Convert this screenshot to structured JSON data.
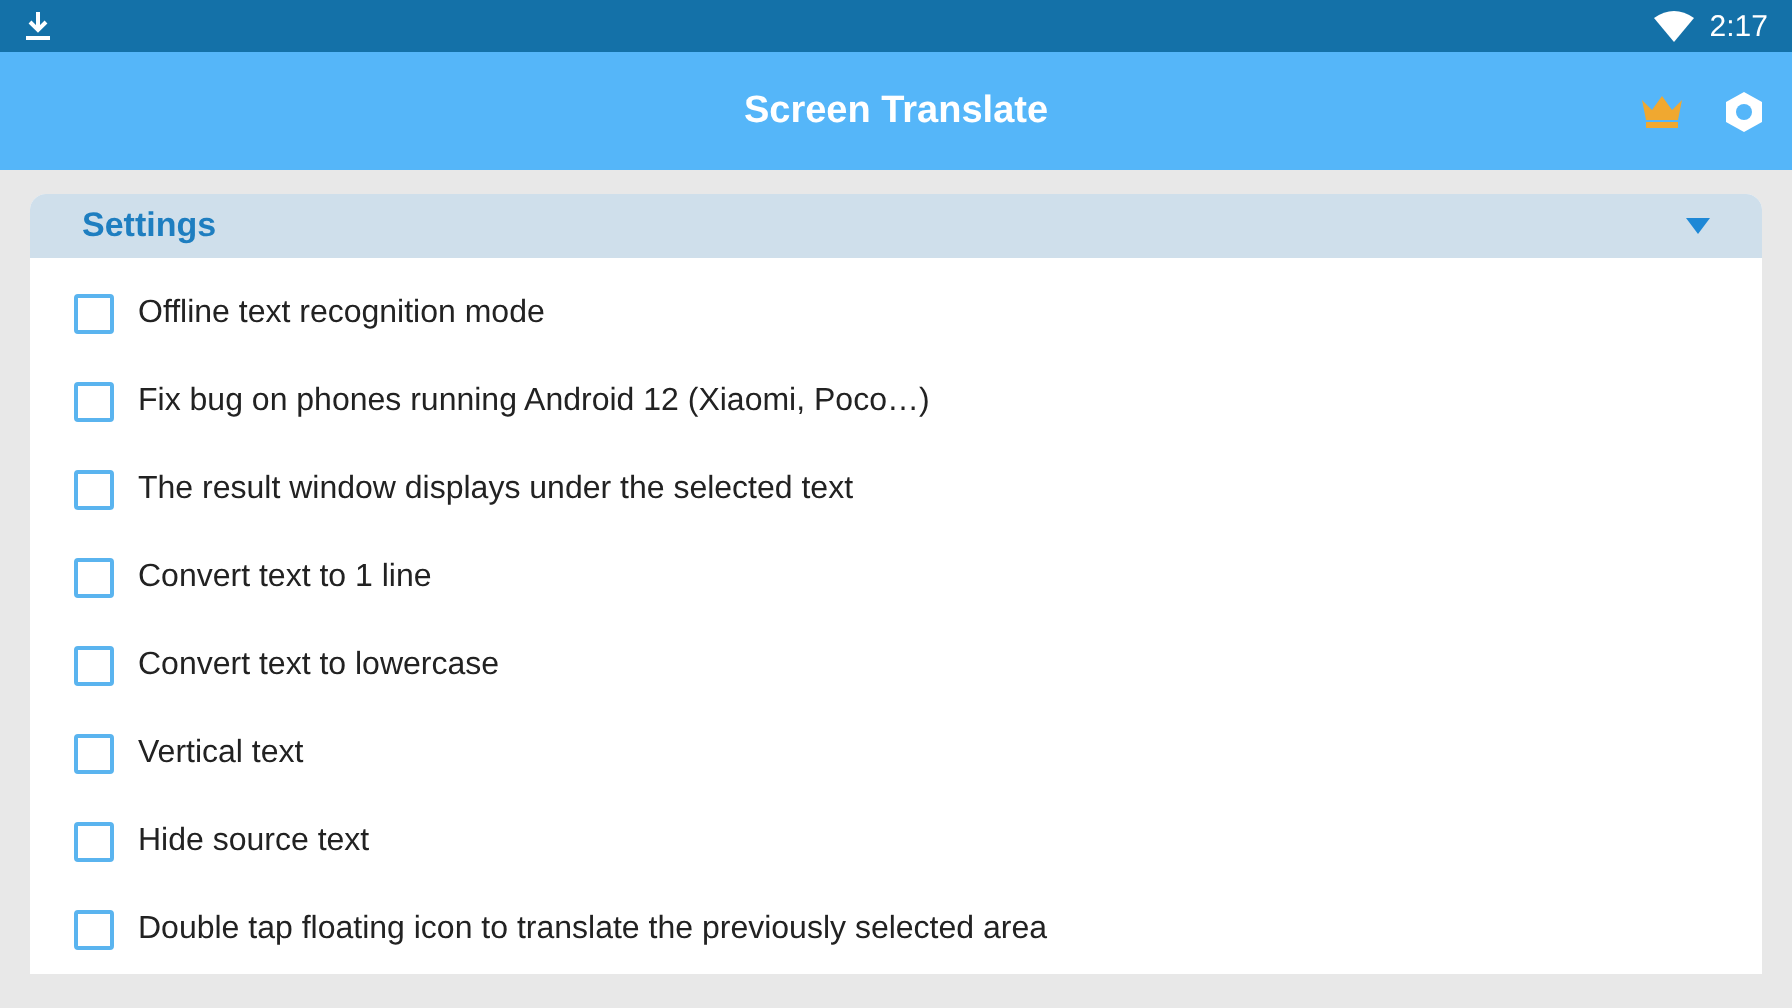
{
  "status_bar": {
    "time": "2:17"
  },
  "app_bar": {
    "title": "Screen Translate"
  },
  "settings": {
    "title": "Settings",
    "expanded": true,
    "options": [
      {
        "label": "Offline text recognition mode",
        "checked": false
      },
      {
        "label": "Fix bug on phones running Android 12 (Xiaomi, Poco…)",
        "checked": false
      },
      {
        "label": "The result window displays under the selected text",
        "checked": false
      },
      {
        "label": "Convert text to 1 line",
        "checked": false
      },
      {
        "label": "Convert text to lowercase",
        "checked": false
      },
      {
        "label": "Vertical text",
        "checked": false
      },
      {
        "label": "Hide source text",
        "checked": false
      },
      {
        "label": "Double tap floating icon to translate the previously selected area",
        "checked": false
      }
    ]
  }
}
